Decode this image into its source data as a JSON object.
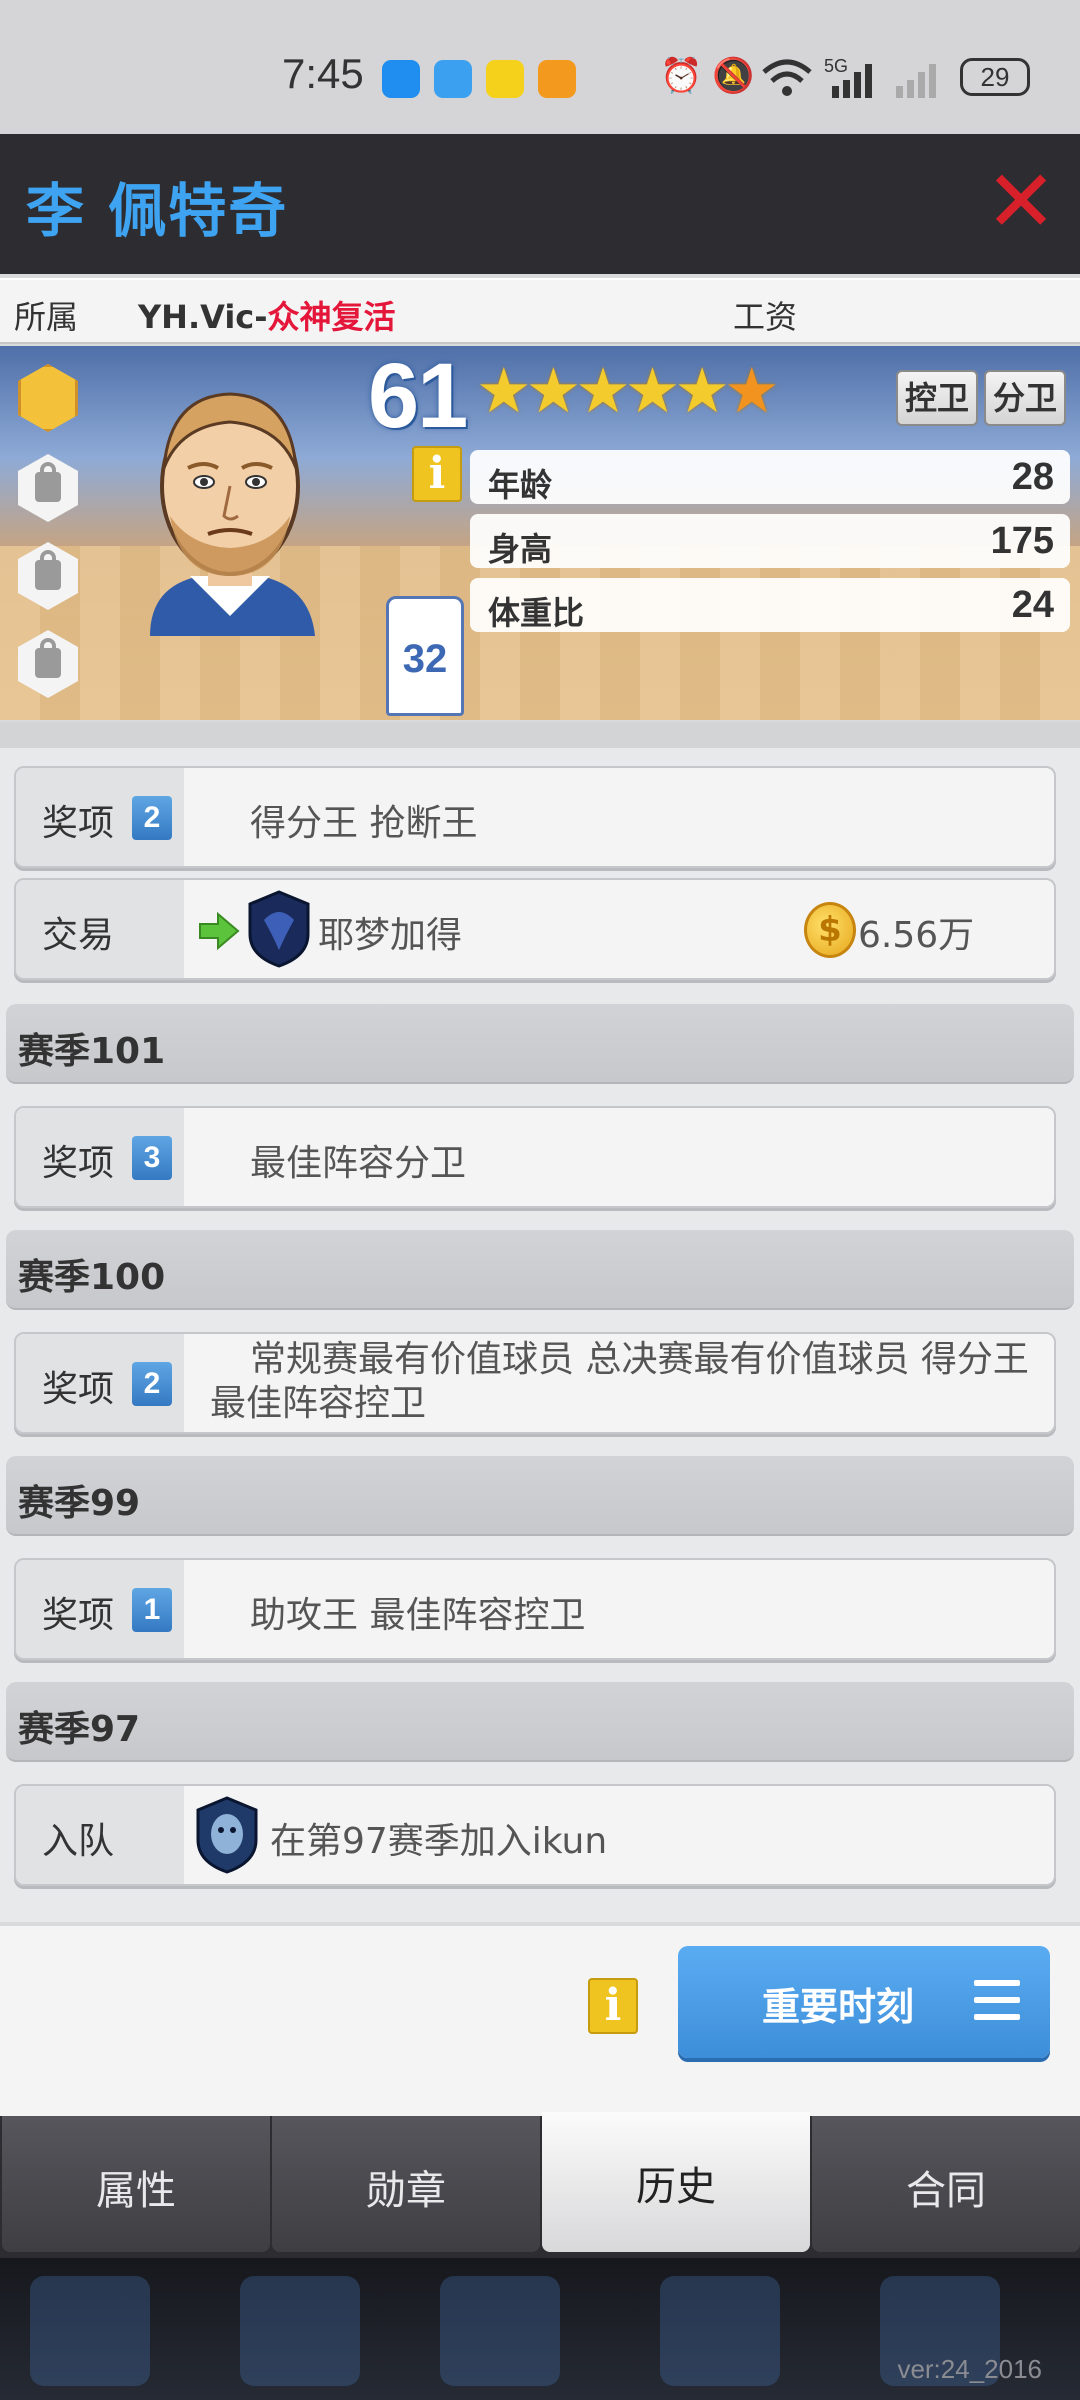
{
  "status_bar": {
    "time": "7:45",
    "battery": "29",
    "network_label": "5G"
  },
  "header": {
    "player_name": "李 佩特奇",
    "close_icon": "close-icon"
  },
  "team_row": {
    "affiliation_label": "所属",
    "team_prefix": "YH.Vic-",
    "team_suffix": "众神复活",
    "salary_label": "工资"
  },
  "card": {
    "rating": "61",
    "stars": 5.5,
    "jersey_number": "32",
    "positions": [
      "控卫",
      "分卫"
    ],
    "stats": [
      {
        "label": "年龄",
        "value": "28"
      },
      {
        "label": "身高",
        "value": "175"
      },
      {
        "label": "体重比",
        "value": "24"
      }
    ]
  },
  "history": {
    "top_entries": [
      {
        "label": "奖项",
        "count": "2",
        "text": "得分王  抢断王"
      },
      {
        "label": "交易",
        "team": "耶梦加得",
        "amount": "6.56万"
      }
    ],
    "seasons": [
      {
        "title": "赛季101",
        "label": "奖项",
        "count": "3",
        "text": "最佳阵容分卫"
      },
      {
        "title": "赛季100",
        "label": "奖项",
        "count": "2",
        "text": "常规赛最有价值球员  总决赛最有价值球员  得分王  最佳阵容控卫"
      },
      {
        "title": "赛季99",
        "label": "奖项",
        "count": "1",
        "text": "助攻王  最佳阵容控卫"
      },
      {
        "title": "赛季97",
        "label": "入队",
        "text": "在第97赛季加入ikun"
      }
    ]
  },
  "bottom": {
    "moments_button": "重要时刻"
  },
  "tabs": [
    {
      "label": "属性",
      "active": false
    },
    {
      "label": "勋章",
      "active": false
    },
    {
      "label": "历史",
      "active": true
    },
    {
      "label": "合同",
      "active": false
    }
  ],
  "version": "ver:24_2016",
  "colors": {
    "accent_blue": "#3ea4f2",
    "close_red": "#d8202a",
    "team_red": "#e4173a"
  }
}
